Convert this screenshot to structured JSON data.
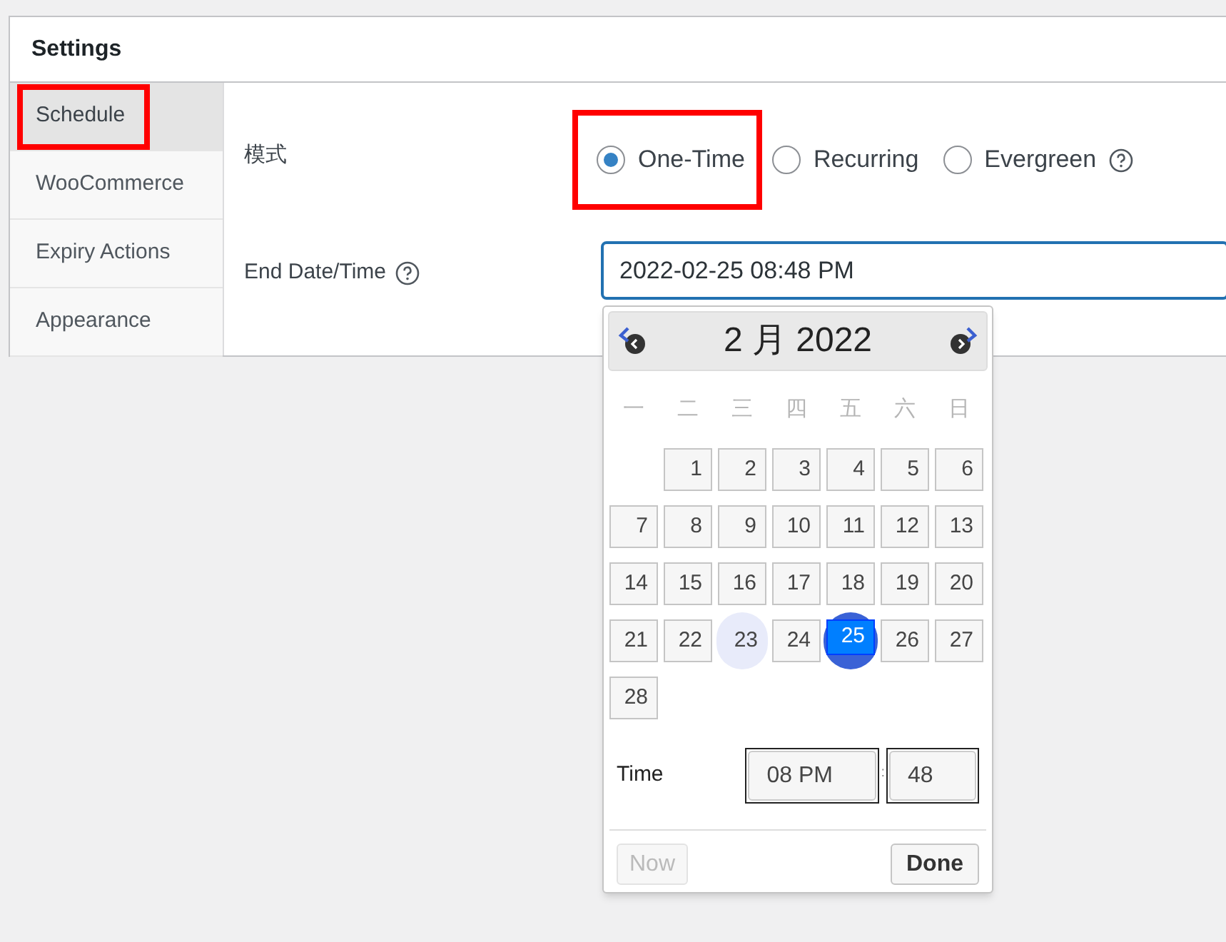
{
  "panel": {
    "title": "Settings"
  },
  "sidebar": {
    "items": [
      {
        "label": "Schedule",
        "selected": true,
        "highlighted": true
      },
      {
        "label": "WooCommerce",
        "selected": false,
        "highlighted": false
      },
      {
        "label": "Expiry Actions",
        "selected": false,
        "highlighted": false
      },
      {
        "label": "Appearance",
        "selected": false,
        "highlighted": false
      }
    ]
  },
  "mode": {
    "label": "模式",
    "options": [
      {
        "label": "One-Time",
        "selected": true,
        "highlighted": true,
        "help": false
      },
      {
        "label": "Recurring",
        "selected": false,
        "highlighted": false,
        "help": false
      },
      {
        "label": "Evergreen",
        "selected": false,
        "highlighted": false,
        "help": true
      }
    ]
  },
  "end_date": {
    "label": "End Date/Time",
    "help": true,
    "value": "2022-02-25 08:48 PM"
  },
  "datepicker": {
    "title": "2 月 2022",
    "weekdays": [
      "一",
      "二",
      "三",
      "四",
      "五",
      "六",
      "日"
    ],
    "weeks": [
      [
        {
          "kind": "blank"
        },
        {
          "kind": "day",
          "day": "1",
          "selected": false,
          "today": false
        },
        {
          "kind": "day",
          "day": "2",
          "selected": false,
          "today": false
        },
        {
          "kind": "day",
          "day": "3",
          "selected": false,
          "today": false
        },
        {
          "kind": "day",
          "day": "4",
          "selected": false,
          "today": false
        },
        {
          "kind": "day",
          "day": "5",
          "selected": false,
          "today": false
        },
        {
          "kind": "day",
          "day": "6",
          "selected": false,
          "today": false
        }
      ],
      [
        {
          "kind": "day",
          "day": "7",
          "selected": false,
          "today": false
        },
        {
          "kind": "day",
          "day": "8",
          "selected": false,
          "today": false
        },
        {
          "kind": "day",
          "day": "9",
          "selected": false,
          "today": false
        },
        {
          "kind": "day",
          "day": "10",
          "selected": false,
          "today": false
        },
        {
          "kind": "day",
          "day": "11",
          "selected": false,
          "today": false
        },
        {
          "kind": "day",
          "day": "12",
          "selected": false,
          "today": false
        },
        {
          "kind": "day",
          "day": "13",
          "selected": false,
          "today": false
        }
      ],
      [
        {
          "kind": "day",
          "day": "14",
          "selected": false,
          "today": false
        },
        {
          "kind": "day",
          "day": "15",
          "selected": false,
          "today": false
        },
        {
          "kind": "day",
          "day": "16",
          "selected": false,
          "today": false
        },
        {
          "kind": "day",
          "day": "17",
          "selected": false,
          "today": false
        },
        {
          "kind": "day",
          "day": "18",
          "selected": false,
          "today": false
        },
        {
          "kind": "day",
          "day": "19",
          "selected": false,
          "today": false
        },
        {
          "kind": "day",
          "day": "20",
          "selected": false,
          "today": false
        }
      ],
      [
        {
          "kind": "day",
          "day": "21",
          "selected": false,
          "today": false
        },
        {
          "kind": "day",
          "day": "22",
          "selected": false,
          "today": false
        },
        {
          "kind": "day",
          "day": "23",
          "selected": false,
          "today": true
        },
        {
          "kind": "day",
          "day": "24",
          "selected": false,
          "today": false
        },
        {
          "kind": "day",
          "day": "25",
          "selected": true,
          "today": false
        },
        {
          "kind": "day",
          "day": "26",
          "selected": false,
          "today": false
        },
        {
          "kind": "day",
          "day": "27",
          "selected": false,
          "today": false
        }
      ],
      [
        {
          "kind": "day",
          "day": "28",
          "selected": false,
          "today": false
        }
      ]
    ],
    "time_label": "Time",
    "hour": "08 PM",
    "separator": ":",
    "minute": "48",
    "buttons": [
      {
        "label": "Now",
        "disabled": true,
        "kind": "now"
      },
      {
        "label": "Done",
        "disabled": false,
        "kind": "done"
      }
    ]
  }
}
